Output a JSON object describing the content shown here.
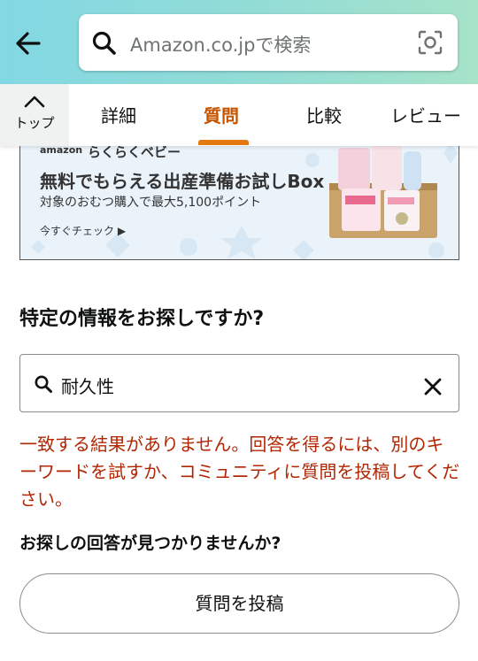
{
  "header": {
    "back_icon": "arrow-left-icon",
    "search_placeholder": "Amazon.co.jpで検索",
    "search_icon": "search-icon",
    "camera_icon": "camera-scan-icon"
  },
  "tabs": {
    "top_label": "トップ",
    "items": [
      {
        "label": "詳細",
        "active": false
      },
      {
        "label": "質問",
        "active": true
      },
      {
        "label": "比較",
        "active": false
      },
      {
        "label": "レビュー",
        "active": false
      }
    ],
    "active_color": "#c45500",
    "underline_color": "#e47911"
  },
  "banner": {
    "brand_small": "amazon",
    "brand_main": "らくらくベビー",
    "headline": "無料でもらえる出産準備お試しBox",
    "subtext": "対象のおむつ購入で最大5,100ポイント",
    "cta": "今すぐチェック ▶"
  },
  "qa": {
    "section_title": "特定の情報をお探しですか?",
    "search_value": "耐久性",
    "error_message": "一致する結果がありません。回答を得るには、別のキーワードを試すか、コミュニティに質問を投稿してください。",
    "error_color": "#b12704",
    "not_found_heading": "お探しの回答が見つかりませんか?",
    "post_button": "質問を投稿"
  },
  "colors": {
    "header_gradient_start": "#82d8e3",
    "header_gradient_end": "#a6e3c9"
  }
}
